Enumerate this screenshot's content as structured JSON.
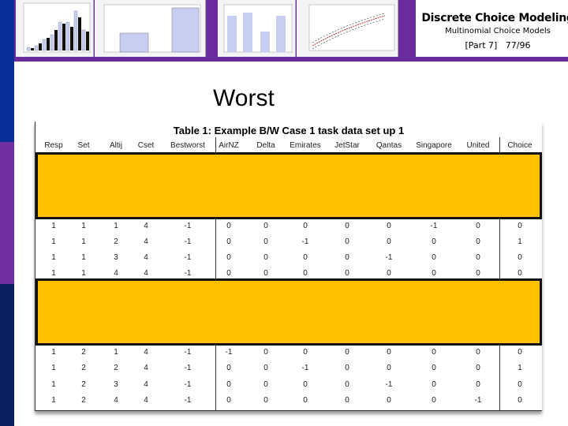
{
  "header": {
    "title": "Discrete Choice Modeling",
    "subtitle": "Multinomial Choice Models",
    "part": "[Part 7]",
    "page": "77/96"
  },
  "slide": {
    "heading": "Worst"
  },
  "table": {
    "caption": "Table 1: Example B/W Case 1 task data set up 1",
    "columns": [
      "Resp",
      "Set",
      "Altij",
      "Cset",
      "Bestworst",
      "AirNZ",
      "Delta",
      "Emirates",
      "JetStar",
      "Qantas",
      "Singapore",
      "United",
      "Choice"
    ],
    "rows": [
      [
        "1",
        "1",
        "1",
        "4",
        "-1",
        "0",
        "0",
        "0",
        "0",
        "0",
        "-1",
        "0",
        "0"
      ],
      [
        "1",
        "1",
        "2",
        "4",
        "-1",
        "0",
        "0",
        "-1",
        "0",
        "0",
        "0",
        "0",
        "1"
      ],
      [
        "1",
        "1",
        "3",
        "4",
        "-1",
        "0",
        "0",
        "0",
        "0",
        "-1",
        "0",
        "0",
        "0"
      ],
      [
        "1",
        "1",
        "4",
        "4",
        "-1",
        "0",
        "0",
        "0",
        "0",
        "0",
        "0",
        "0",
        "0"
      ],
      [
        "1",
        "2",
        "1",
        "4",
        "-1",
        "-1",
        "0",
        "0",
        "0",
        "0",
        "0",
        "0",
        "0"
      ],
      [
        "1",
        "2",
        "2",
        "4",
        "-1",
        "0",
        "0",
        "-1",
        "0",
        "0",
        "0",
        "0",
        "1"
      ],
      [
        "1",
        "2",
        "3",
        "4",
        "-1",
        "0",
        "0",
        "0",
        "0",
        "-1",
        "0",
        "0",
        "0"
      ],
      [
        "1",
        "2",
        "4",
        "4",
        "-1",
        "0",
        "0",
        "0",
        "0",
        "0",
        "0",
        "-1",
        "0"
      ]
    ]
  },
  "colors": {
    "highlight": "#ffc000",
    "banner": "#6a2c9c",
    "sidebar_top": "#0a2e9a",
    "sidebar_mid": "#7030a0",
    "sidebar_bottom": "#0a1f5e"
  }
}
